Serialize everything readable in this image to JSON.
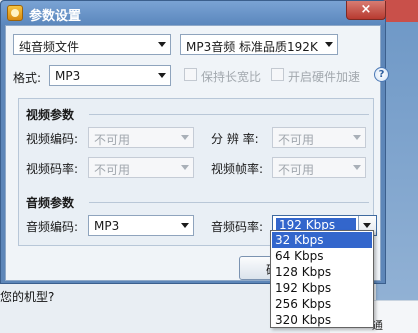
{
  "dialog": {
    "title": "参数设置",
    "close_glyph": "×"
  },
  "preset": {
    "type": "纯音频文件",
    "quality": "MP3音频 标准品质192K"
  },
  "format": {
    "label": "格式:",
    "value": "MP3",
    "keep_aspect_label": "保持长宽比",
    "hw_accel_label": "开启硬件加速",
    "help_glyph": "?"
  },
  "video": {
    "section_title": "视频参数",
    "codec_label": "视频编码:",
    "codec_value": "不可用",
    "resolution_label": "分 辨 率:",
    "resolution_value": "不可用",
    "bitrate_label": "视频码率:",
    "bitrate_value": "不可用",
    "framerate_label": "视频帧率:",
    "framerate_value": "不可用"
  },
  "audio": {
    "section_title": "音频参数",
    "codec_label": "音频编码:",
    "codec_value": "MP3",
    "bitrate_label": "音频码率:",
    "bitrate_value": "192 Kbps",
    "bitrate_options": [
      "32 Kbps",
      "64 Kbps",
      "128 Kbps",
      "192 Kbps",
      "256 Kbps",
      "320 Kbps"
    ],
    "highlighted_option": "32 Kbps"
  },
  "buttons": {
    "confirm_fragment": "确"
  },
  "background": {
    "question_text": "您的机型?",
    "corner_text": "通"
  },
  "colors": {
    "titlebar": "#5b87bd",
    "selection": "#3366cc",
    "close": "#c9504a"
  }
}
